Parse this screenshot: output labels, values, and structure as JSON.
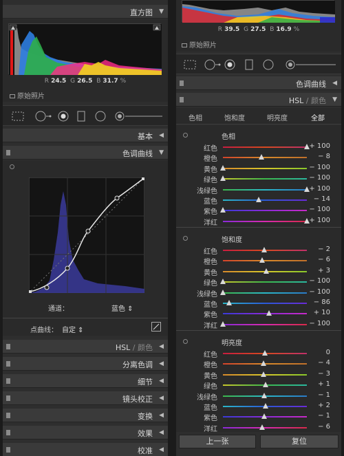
{
  "left": {
    "histogram": {
      "title": "直方图",
      "r_label": "R",
      "r_value": "24.5",
      "g_label": "G",
      "g_value": "26.5",
      "b_label": "B",
      "b_value": "31.7",
      "pct": "%",
      "original": "原始照片"
    },
    "basic": "基本",
    "tone_curve": {
      "title": "色调曲线",
      "channel_label": "通道：",
      "channel_value": "蓝色 ⇕",
      "point_curve_label": "点曲线：",
      "point_curve_value": "自定 ⇕"
    },
    "sections": [
      "HSL",
      "颜色",
      "分离色调",
      "细节",
      "镜头校正",
      "变换",
      "效果",
      "校准"
    ]
  },
  "right": {
    "histogram": {
      "r_label": "R",
      "r_value": "39.5",
      "g_label": "G",
      "g_value": "27.5",
      "b_label": "B",
      "b_value": "16.9",
      "pct": "%",
      "original": "原始照片"
    },
    "tone_curve": "色调曲线",
    "hsl_header": {
      "hsl": "HSL",
      "sep": "/",
      "color": "颜色"
    },
    "tabs": [
      "色相",
      "饱和度",
      "明亮度",
      "全部"
    ],
    "groups": [
      {
        "title": "色相",
        "rows": [
          {
            "label": "红色",
            "value": "+ 100",
            "pos": 1.0
          },
          {
            "label": "橙色",
            "value": "− 8",
            "pos": 0.46
          },
          {
            "label": "黄色",
            "value": "− 100",
            "pos": 0.0
          },
          {
            "label": "绿色",
            "value": "− 100",
            "pos": 0.0
          },
          {
            "label": "浅绿色",
            "value": "+ 100",
            "pos": 1.0
          },
          {
            "label": "蓝色",
            "value": "− 14",
            "pos": 0.43
          },
          {
            "label": "紫色",
            "value": "− 100",
            "pos": 0.0
          },
          {
            "label": "洋红",
            "value": "+ 100",
            "pos": 1.0
          }
        ]
      },
      {
        "title": "饱和度",
        "rows": [
          {
            "label": "红色",
            "value": "− 2",
            "pos": 0.49
          },
          {
            "label": "橙色",
            "value": "− 6",
            "pos": 0.47
          },
          {
            "label": "黄色",
            "value": "+ 3",
            "pos": 0.52
          },
          {
            "label": "绿色",
            "value": "− 100",
            "pos": 0.0
          },
          {
            "label": "浅绿色",
            "value": "− 100",
            "pos": 0.0
          },
          {
            "label": "蓝色",
            "value": "− 86",
            "pos": 0.07
          },
          {
            "label": "紫色",
            "value": "+ 10",
            "pos": 0.55
          },
          {
            "label": "洋红",
            "value": "− 100",
            "pos": 0.0
          }
        ]
      },
      {
        "title": "明亮度",
        "rows": [
          {
            "label": "红色",
            "value": "0",
            "pos": 0.5
          },
          {
            "label": "橙色",
            "value": "− 4",
            "pos": 0.48
          },
          {
            "label": "黄色",
            "value": "− 3",
            "pos": 0.485
          },
          {
            "label": "绿色",
            "value": "+ 1",
            "pos": 0.505
          },
          {
            "label": "浅绿色",
            "value": "− 1",
            "pos": 0.495
          },
          {
            "label": "蓝色",
            "value": "+ 2",
            "pos": 0.51
          },
          {
            "label": "紫色",
            "value": "− 1",
            "pos": 0.495
          },
          {
            "label": "洋红",
            "value": "− 6",
            "pos": 0.47
          }
        ]
      }
    ],
    "prev_button": "上一张",
    "reset_button": "复位"
  }
}
